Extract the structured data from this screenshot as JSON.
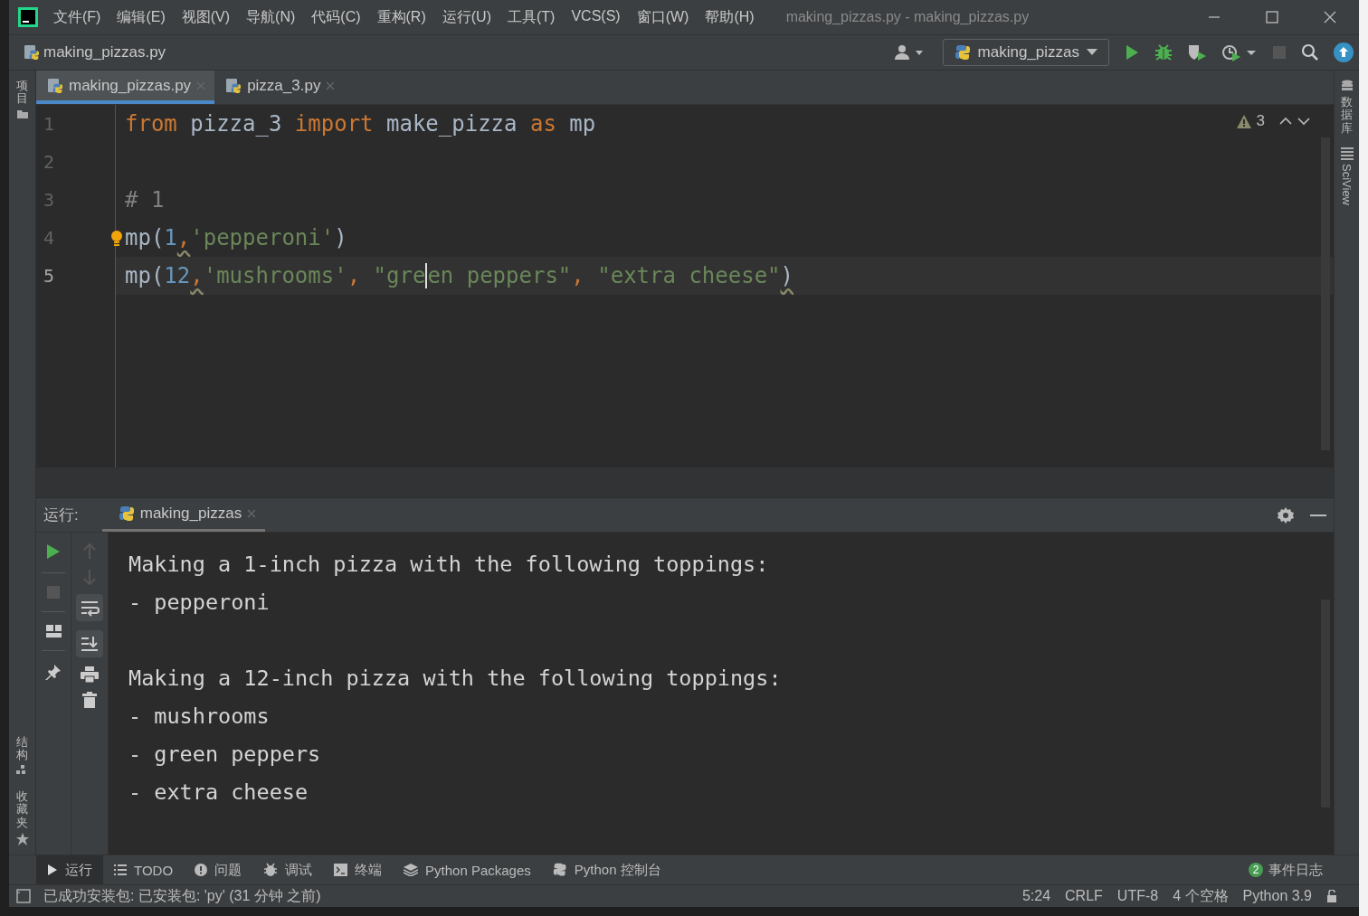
{
  "window": {
    "title": "making_pizzas.py - making_pizzas.py"
  },
  "menu": [
    "文件(F)",
    "编辑(E)",
    "视图(V)",
    "导航(N)",
    "代码(C)",
    "重构(R)",
    "运行(U)",
    "工具(T)",
    "VCS(S)",
    "窗口(W)",
    "帮助(H)"
  ],
  "breadcrumb": "making_pizzas.py",
  "run_config": "making_pizzas",
  "left_tools_top": [
    "项目"
  ],
  "left_tools_bottom": [
    "结构",
    "收藏夹"
  ],
  "right_tools": [
    {
      "label": "数据库",
      "kind": "stacked"
    },
    {
      "label": "SciView",
      "kind": "rotated"
    }
  ],
  "editor_tabs": [
    {
      "label": "making_pizzas.py",
      "selected": true
    },
    {
      "label": "pizza_3.py",
      "selected": false
    }
  ],
  "editor": {
    "warnings": "3",
    "lines": [
      {
        "number": "1",
        "current": false,
        "tokens": [
          {
            "kind": "keyword",
            "text": "from"
          },
          {
            "kind": "plain",
            "text": " pizza_3 "
          },
          {
            "kind": "keyword",
            "text": "import"
          },
          {
            "kind": "plain",
            "text": " make_pizza "
          },
          {
            "kind": "keyword",
            "text": "as"
          },
          {
            "kind": "plain",
            "text": " mp"
          }
        ]
      },
      {
        "number": "2",
        "current": false
      },
      {
        "number": "3",
        "current": false,
        "tokens": [
          {
            "kind": "comment",
            "text": "# 1"
          }
        ]
      },
      {
        "number": "4",
        "current": false,
        "bulb": true,
        "tokens": [
          {
            "kind": "plain",
            "text": "mp("
          },
          {
            "kind": "number",
            "text": "1"
          },
          {
            "kind": "punct",
            "text": ",",
            "warning": true
          },
          {
            "kind": "string",
            "text": "'pepperoni'"
          },
          {
            "kind": "plain",
            "text": ")"
          }
        ]
      },
      {
        "number": "5",
        "current": true,
        "tokens": [
          {
            "kind": "plain",
            "text": "mp("
          },
          {
            "kind": "number",
            "text": "12"
          },
          {
            "kind": "punct",
            "text": ",",
            "warning": true
          },
          {
            "kind": "string",
            "text": "'mushrooms'"
          },
          {
            "kind": "punct",
            "text": ", "
          },
          {
            "kind": "string",
            "text": "\"gre",
            "caret": true
          },
          {
            "kind": "string",
            "text": "en peppers\""
          },
          {
            "kind": "punct",
            "text": ", "
          },
          {
            "kind": "string",
            "text": "\"extra cheese\""
          },
          {
            "kind": "plain",
            "text": ")",
            "warning": true
          }
        ]
      }
    ]
  },
  "run_panel": {
    "label": "运行:",
    "tab": "making_pizzas",
    "output_blocks": [
      [
        "Making a 1-inch pizza with the following toppings:",
        "- pepperoni"
      ],
      [
        "Making a 12-inch pizza with the following toppings:",
        "- mushrooms",
        "- green peppers",
        "- extra cheese"
      ]
    ]
  },
  "tool_tabs": [
    {
      "label": "运行",
      "selected": true
    },
    {
      "label": "TODO",
      "selected": false
    },
    {
      "label": "问题",
      "selected": false
    },
    {
      "label": "调试",
      "selected": false
    },
    {
      "label": "终端",
      "selected": false
    },
    {
      "label": "Python Packages",
      "selected": false
    },
    {
      "label": "Python 控制台",
      "selected": false
    }
  ],
  "event_log": {
    "count": "2",
    "label": "事件日志"
  },
  "status_bar": {
    "message": "已成功安装包: 已安装包: 'py' (31 分钟 之前)",
    "items": [
      "5:24",
      "CRLF",
      "UTF-8",
      "4 个空格",
      "Python 3.9"
    ]
  }
}
